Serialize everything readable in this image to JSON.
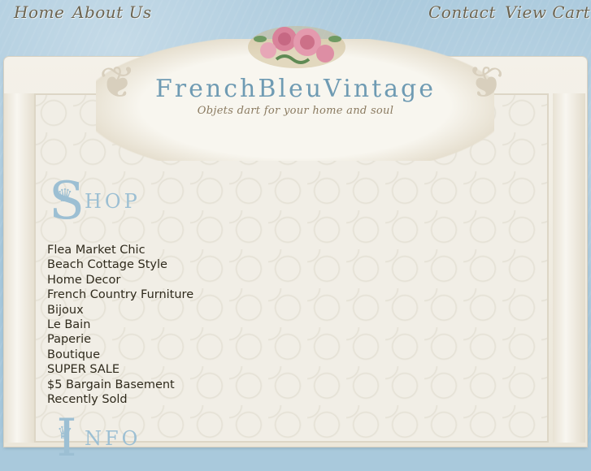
{
  "nav": {
    "home": "Home",
    "about": "About Us",
    "contact": "Contact",
    "view_cart": "View Cart"
  },
  "brand": {
    "title": "FrenchBleuVintage",
    "tagline": "Objets dart for your home and soul"
  },
  "shop": {
    "heading_cap": "S",
    "heading_rest": "HOP",
    "items": [
      "Flea Market Chic",
      "Beach Cottage Style",
      "Home Decor",
      "French Country Furniture",
      "Bijoux",
      "Le Bain",
      "Paperie",
      "Boutique",
      "SUPER SALE",
      "$5 Bargain Basement",
      "Recently Sold"
    ]
  },
  "info": {
    "heading_cap": "I",
    "heading_rest": "NFO"
  },
  "colors": {
    "wall": "#a6c7db",
    "accent_blue": "#6f9bb3",
    "nav_text": "#6a6350",
    "menu_text": "#2f2a1c"
  }
}
